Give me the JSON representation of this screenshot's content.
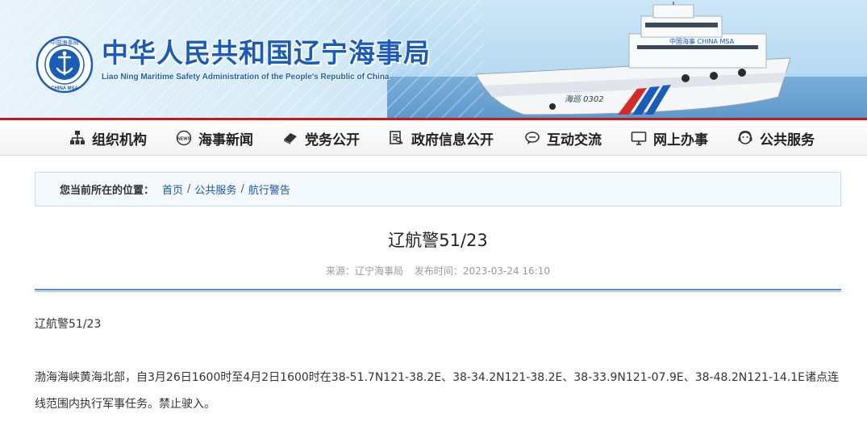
{
  "header": {
    "title": "中华人民共和国辽宁海事局",
    "subtitle": "Liao Ning Maritime Safety Administration of the People's Republic of China",
    "emblem_text": "中国海事局",
    "emblem_sub": "CHINA MSA",
    "ship_name": "海巡 0302",
    "ship_hull_text": "中国海事 CHINA MSA",
    "brand_color": "#1b5cb8",
    "accent_color": "#c8161d"
  },
  "nav": {
    "items": [
      {
        "label": "组织机构",
        "icon": "org-chart-icon"
      },
      {
        "label": "海事新闻",
        "icon": "news-icon"
      },
      {
        "label": "党务公开",
        "icon": "party-icon"
      },
      {
        "label": "政府信息公开",
        "icon": "document-icon"
      },
      {
        "label": "互动交流",
        "icon": "chat-icon"
      },
      {
        "label": "网上办事",
        "icon": "monitor-icon"
      },
      {
        "label": "公共服务",
        "icon": "service-icon"
      }
    ]
  },
  "breadcrumb": {
    "label": "您当前所在的位置：",
    "items": [
      "首页",
      "公共服务",
      "航行警告"
    ],
    "separator": "/"
  },
  "article": {
    "title": "辽航警51/23",
    "source": "来源：辽宁海事局",
    "published": "发布时间：2023-03-24 16:10",
    "paragraphs": [
      "辽航警51/23",
      "渤海海峡黄海北部，自3月26日1600时至4月2日1600时在38-51.7N121-38.2E、38-34.2N121-38.2E、38-33.9N121-07.9E、38-48.2N121-14.1E诸点连线范围内执行军事任务。禁止驶入。"
    ]
  }
}
